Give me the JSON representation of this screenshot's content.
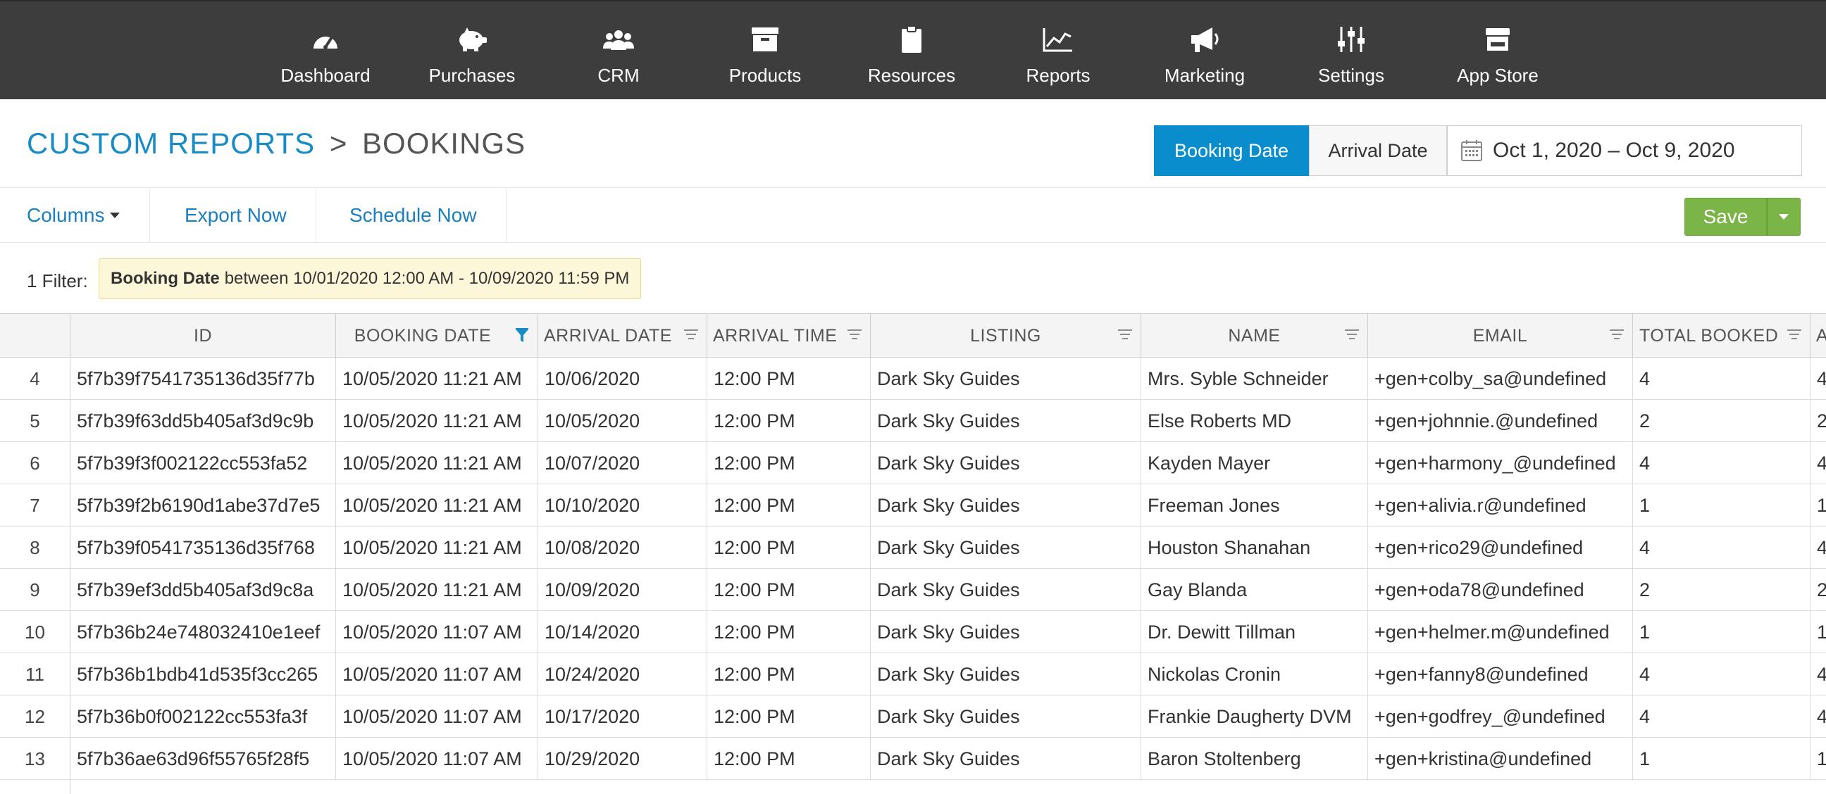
{
  "nav": {
    "items": [
      {
        "label": "Dashboard",
        "icon": "gauge-icon"
      },
      {
        "label": "Purchases",
        "icon": "piggy-bank-icon"
      },
      {
        "label": "CRM",
        "icon": "people-icon"
      },
      {
        "label": "Products",
        "icon": "box-icon"
      },
      {
        "label": "Resources",
        "icon": "clipboard-icon"
      },
      {
        "label": "Reports",
        "icon": "line-chart-icon"
      },
      {
        "label": "Marketing",
        "icon": "megaphone-icon"
      },
      {
        "label": "Settings",
        "icon": "sliders-icon"
      },
      {
        "label": "App Store",
        "icon": "store-icon"
      }
    ]
  },
  "header": {
    "breadcrumb_link": "CUSTOM REPORTS",
    "breadcrumb_sep": ">",
    "breadcrumb_current": "BOOKINGS",
    "date_toggle": {
      "active": "Booking Date",
      "inactive": "Arrival Date"
    },
    "date_range": "Oct 1, 2020 – Oct 9, 2020"
  },
  "toolbar": {
    "columns_label": "Columns",
    "export_label": "Export Now",
    "schedule_label": "Schedule Now",
    "save_label": "Save"
  },
  "filter": {
    "label": "1 Filter:",
    "field": "Booking Date",
    "text": "between 10/01/2020 12:00 AM - 10/09/2020 11:59 PM"
  },
  "table": {
    "columns": [
      "ID",
      "BOOKING DATE",
      "ARRIVAL DATE",
      "ARRIVAL TIME",
      "LISTING",
      "NAME",
      "EMAIL",
      "TOTAL BOOKED",
      "A"
    ],
    "rows": [
      {
        "num": "4",
        "id": "5f7b39f7541735136d35f77b",
        "booking_date": "10/05/2020 11:21 AM",
        "arrival_date": "10/06/2020",
        "arrival_time": "12:00 PM",
        "listing": "Dark Sky Guides",
        "name": "Mrs. Syble Schneider",
        "email": "+gen+colby_sa@undefined",
        "total_booked": "4",
        "extra": "4"
      },
      {
        "num": "5",
        "id": "5f7b39f63dd5b405af3d9c9b",
        "booking_date": "10/05/2020 11:21 AM",
        "arrival_date": "10/05/2020",
        "arrival_time": "12:00 PM",
        "listing": "Dark Sky Guides",
        "name": "Else Roberts MD",
        "email": "+gen+johnnie.@undefined",
        "total_booked": "2",
        "extra": "2"
      },
      {
        "num": "6",
        "id": "5f7b39f3f002122cc553fa52",
        "booking_date": "10/05/2020 11:21 AM",
        "arrival_date": "10/07/2020",
        "arrival_time": "12:00 PM",
        "listing": "Dark Sky Guides",
        "name": "Kayden Mayer",
        "email": "+gen+harmony_@undefined",
        "total_booked": "4",
        "extra": "4"
      },
      {
        "num": "7",
        "id": "5f7b39f2b6190d1abe37d7e5",
        "booking_date": "10/05/2020 11:21 AM",
        "arrival_date": "10/10/2020",
        "arrival_time": "12:00 PM",
        "listing": "Dark Sky Guides",
        "name": "Freeman Jones",
        "email": "+gen+alivia.r@undefined",
        "total_booked": "1",
        "extra": "1"
      },
      {
        "num": "8",
        "id": "5f7b39f0541735136d35f768",
        "booking_date": "10/05/2020 11:21 AM",
        "arrival_date": "10/08/2020",
        "arrival_time": "12:00 PM",
        "listing": "Dark Sky Guides",
        "name": "Houston Shanahan",
        "email": "+gen+rico29@undefined",
        "total_booked": "4",
        "extra": "4"
      },
      {
        "num": "9",
        "id": "5f7b39ef3dd5b405af3d9c8a",
        "booking_date": "10/05/2020 11:21 AM",
        "arrival_date": "10/09/2020",
        "arrival_time": "12:00 PM",
        "listing": "Dark Sky Guides",
        "name": "Gay Blanda",
        "email": "+gen+oda78@undefined",
        "total_booked": "2",
        "extra": "2"
      },
      {
        "num": "10",
        "id": "5f7b36b24e748032410e1eef",
        "booking_date": "10/05/2020 11:07 AM",
        "arrival_date": "10/14/2020",
        "arrival_time": "12:00 PM",
        "listing": "Dark Sky Guides",
        "name": "Dr. Dewitt Tillman",
        "email": "+gen+helmer.m@undefined",
        "total_booked": "1",
        "extra": "1"
      },
      {
        "num": "11",
        "id": "5f7b36b1bdb41d535f3cc265",
        "booking_date": "10/05/2020 11:07 AM",
        "arrival_date": "10/24/2020",
        "arrival_time": "12:00 PM",
        "listing": "Dark Sky Guides",
        "name": "Nickolas Cronin",
        "email": "+gen+fanny8@undefined",
        "total_booked": "4",
        "extra": "4"
      },
      {
        "num": "12",
        "id": "5f7b36b0f002122cc553fa3f",
        "booking_date": "10/05/2020 11:07 AM",
        "arrival_date": "10/17/2020",
        "arrival_time": "12:00 PM",
        "listing": "Dark Sky Guides",
        "name": "Frankie Daugherty DVM",
        "email": "+gen+godfrey_@undefined",
        "total_booked": "4",
        "extra": "4"
      },
      {
        "num": "13",
        "id": "5f7b36ae63d96f55765f28f5",
        "booking_date": "10/05/2020 11:07 AM",
        "arrival_date": "10/29/2020",
        "arrival_time": "12:00 PM",
        "listing": "Dark Sky Guides",
        "name": "Baron Stoltenberg",
        "email": "+gen+kristina@undefined",
        "total_booked": "1",
        "extra": "1"
      }
    ]
  },
  "colors": {
    "nav_bg": "#3d3d3d",
    "accent_blue": "#0a8dcd",
    "link_blue": "#1a7fc0",
    "save_green": "#7cb547",
    "filter_bg": "#fdf7d9"
  }
}
